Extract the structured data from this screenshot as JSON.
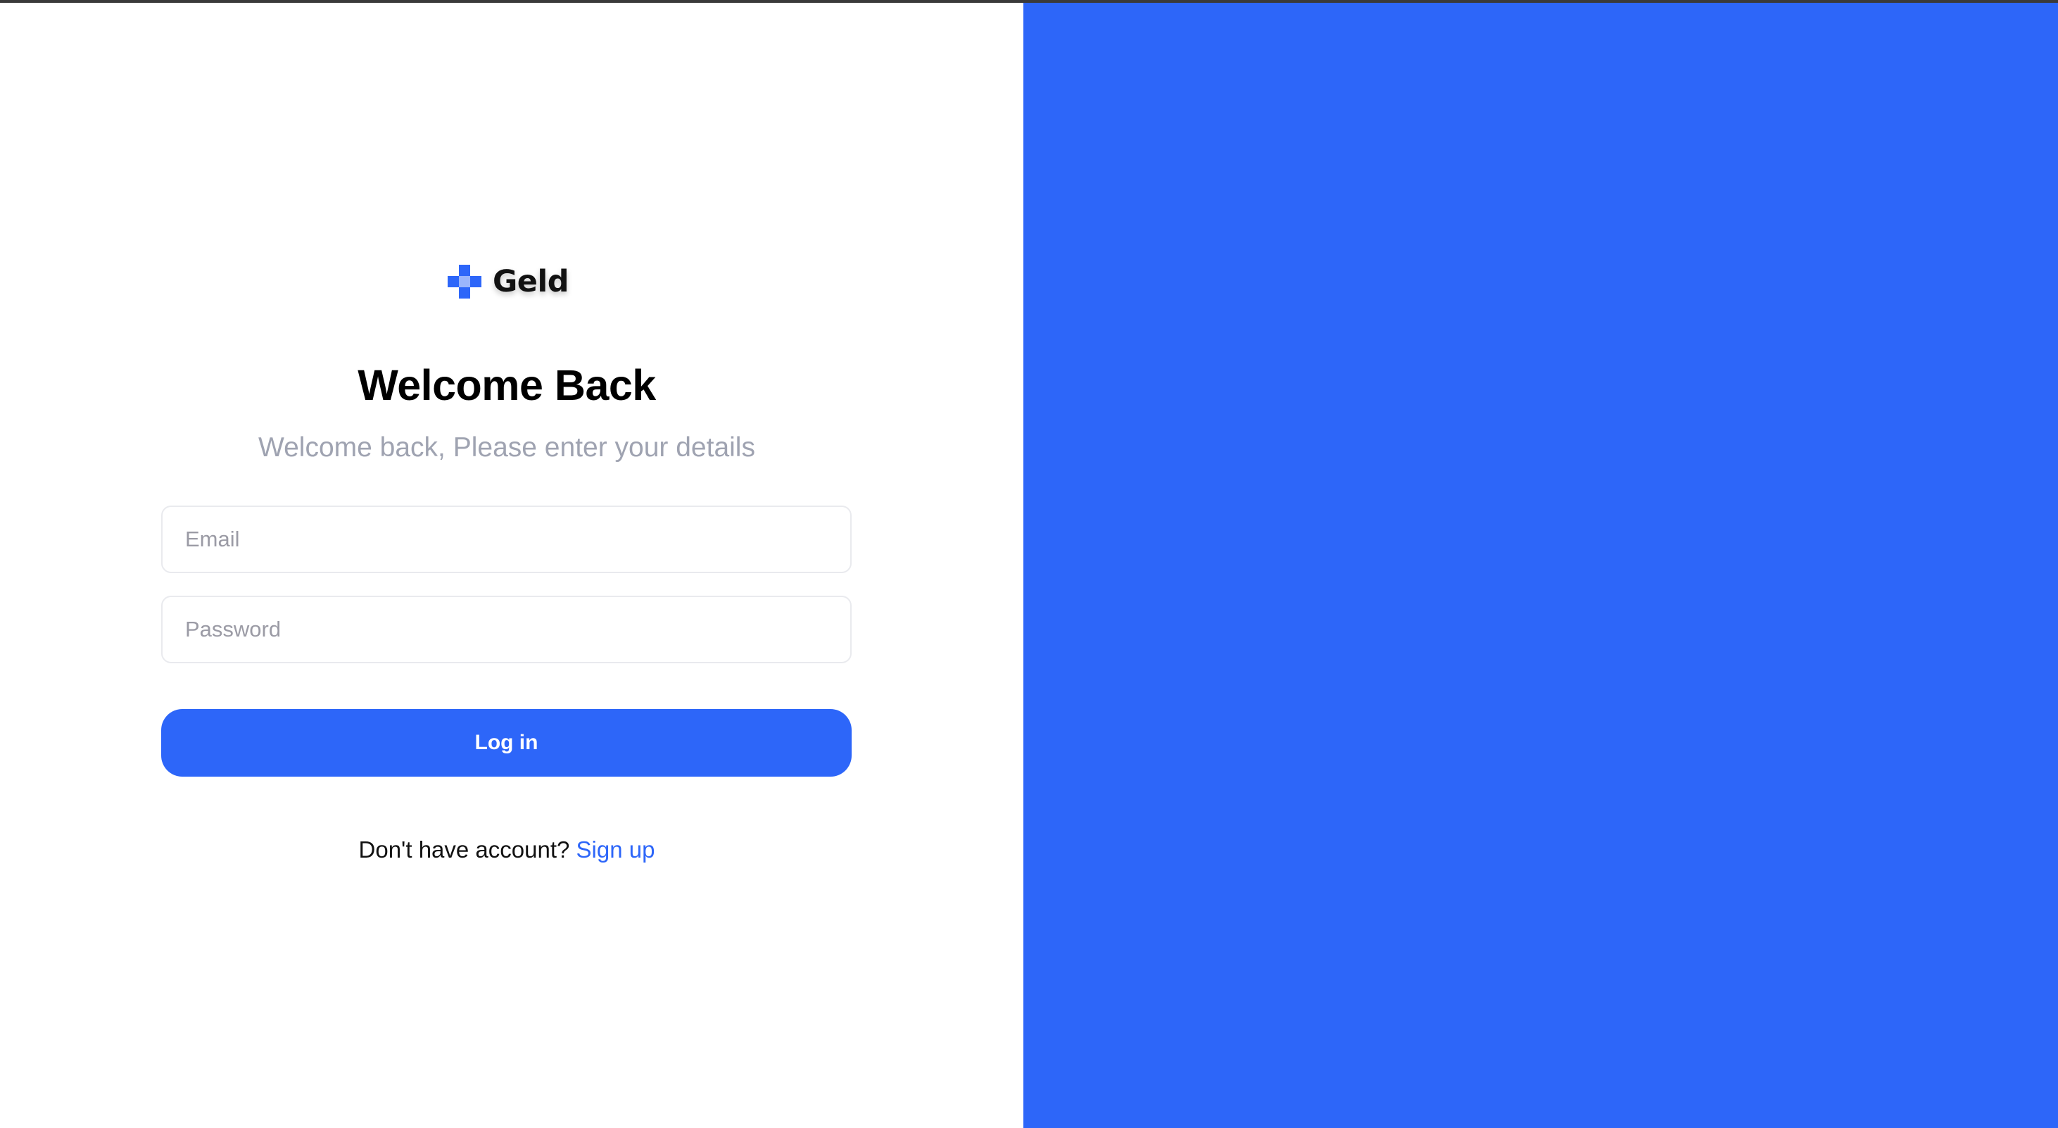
{
  "brand": {
    "name": "Geld",
    "logo_icon": "checkered-cross-logo-icon",
    "logo_color": "#2d66f9"
  },
  "login": {
    "title": "Welcome Back",
    "subtitle": "Welcome back, Please enter your details",
    "email_placeholder": "Email",
    "email_value": "",
    "password_placeholder": "Password",
    "password_value": "",
    "login_button_label": "Log in",
    "signup_prompt": "Don't have account?",
    "signup_link_label": "Sign up"
  },
  "colors": {
    "accent": "#2d66f9",
    "subtitle_text": "#9fa3b1",
    "field_border": "#e9eaee",
    "background": "#ffffff"
  }
}
